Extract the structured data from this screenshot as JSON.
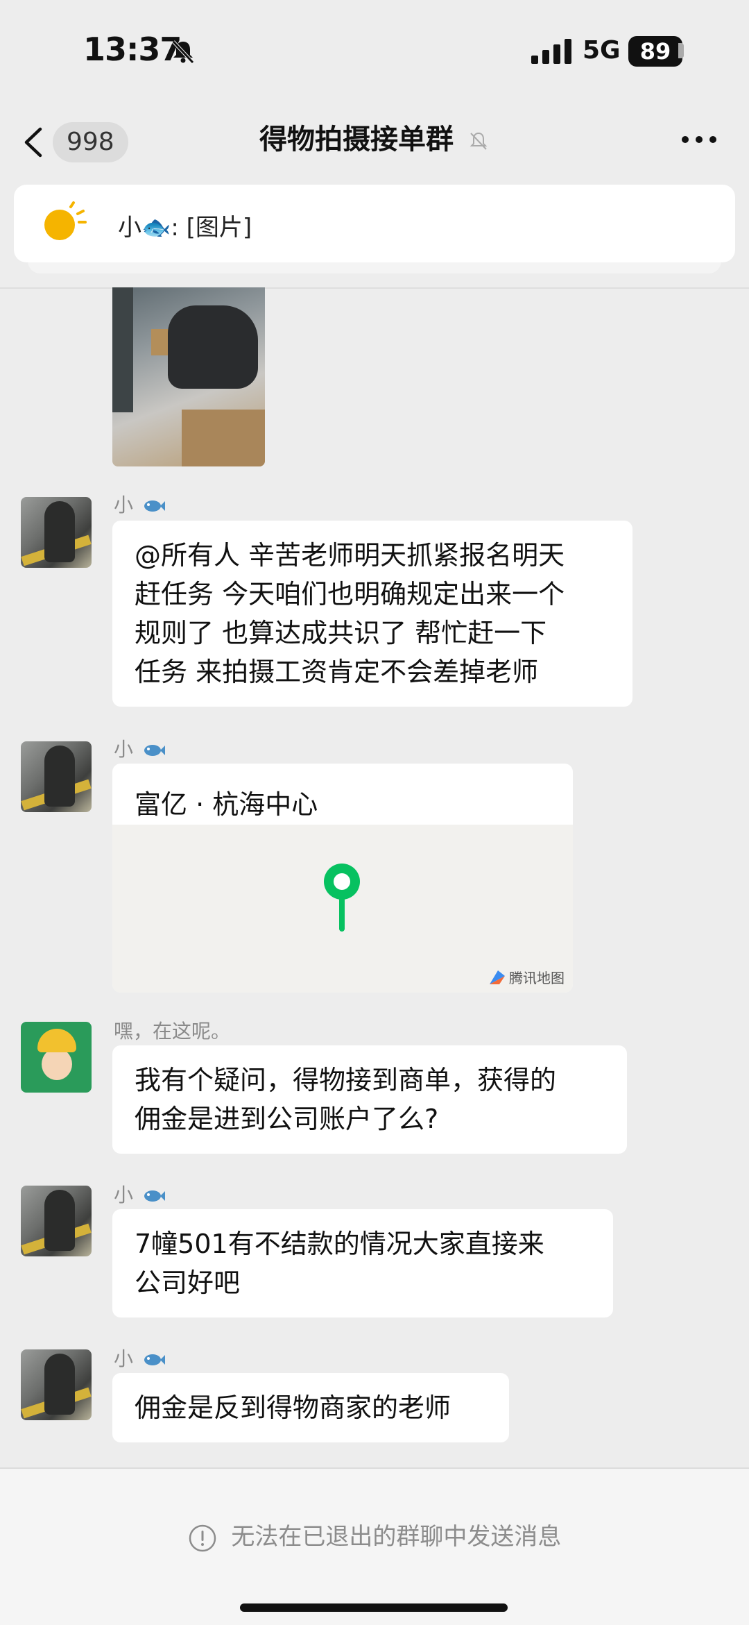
{
  "status_bar": {
    "time": "13:37",
    "network": "5G",
    "battery": "89"
  },
  "nav": {
    "unread_count": "998",
    "title": "得物拍摄接单群"
  },
  "pinned": {
    "text": "小🐟: [图片]"
  },
  "messages": [
    {
      "sender": "小",
      "lines": [
        "@所有人 辛苦老师明天抓紧报名明天",
        "赶任务 今天咱们也明确规定出来一个",
        "规则了 也算达成共识了 帮忙赶一下",
        "任务 来拍摄工资肯定不会差掉老师"
      ]
    },
    {
      "sender": "小",
      "location": {
        "title": "富亿 · 杭海中心",
        "brand": "腾讯地图"
      }
    },
    {
      "sender": "嘿，在这呢。",
      "lines": [
        "我有个疑问，得物接到商单，获得的",
        "佣金是进到公司账户了么?"
      ]
    },
    {
      "sender": "小",
      "lines": [
        "7幢501有不结款的情况大家直接来",
        "公司好吧"
      ]
    },
    {
      "sender": "小",
      "lines": [
        "佣金是反到得物商家的老师"
      ]
    }
  ],
  "footer": {
    "notice": "无法在已退出的群聊中发送消息"
  },
  "colors": {
    "background": "#ededed",
    "bubble": "#ffffff",
    "map_pin": "#07c160"
  }
}
